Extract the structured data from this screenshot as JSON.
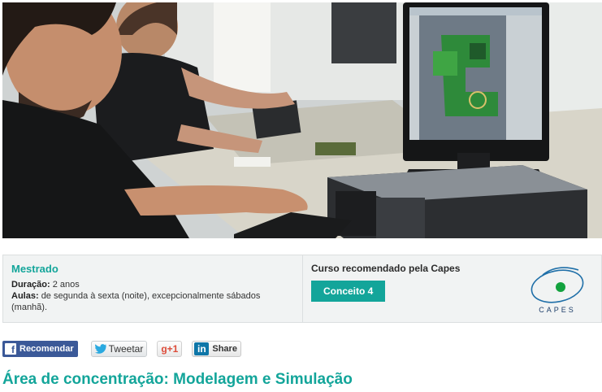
{
  "program": {
    "level": "Mestrado",
    "duration_label": "Duração:",
    "duration_value": "2 anos",
    "classes_label": "Aulas:",
    "classes_value": "de segunda à sexta (noite), excepcionalmente sábados (manhã)."
  },
  "recommendation": {
    "text": "Curso recomendado pela Capes",
    "concept_button": "Conceito 4",
    "logo_text": "CAPES"
  },
  "social": {
    "facebook_label": "Recomendar",
    "facebook_icon": "f",
    "twitter_label": "Tweetar",
    "gplus_label": "+1",
    "gplus_icon": "g",
    "linkedin_icon": "in",
    "linkedin_label": "Share"
  },
  "area_title": "Área de concentração: Modelagem e Simulação",
  "colors": {
    "accent": "#13a59a",
    "facebook": "#3b5998",
    "linkedin": "#0e76a8",
    "gplus": "#dd4b39"
  }
}
